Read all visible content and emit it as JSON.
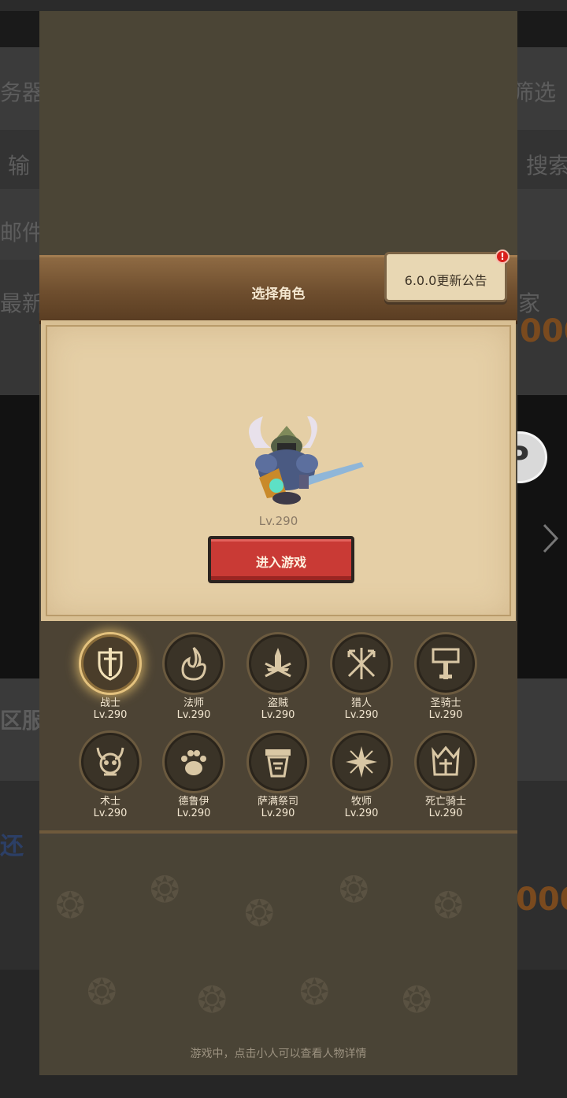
{
  "background_app": {
    "row_left_texts": [
      "务器",
      "输",
      "邮件",
      "最新",
      "区服",
      "还"
    ],
    "filter_label": "筛选",
    "search_label": "搜索",
    "right_fragment": "家",
    "orange_number": "000"
  },
  "game": {
    "header_title": "选择角色",
    "notice_label": "6.0.0更新公告",
    "notice_badge": "!",
    "selected_level": "Lv.290",
    "enter_button": "进入游戏",
    "hint": "游戏中，点击小人可以查看人物详情",
    "classes": [
      {
        "name": "战士",
        "level": "Lv.290",
        "icon": "shield-sword-icon",
        "selected": true
      },
      {
        "name": "法师",
        "level": "Lv.290",
        "icon": "flame-icon"
      },
      {
        "name": "盗贼",
        "level": "Lv.290",
        "icon": "dagger-icon"
      },
      {
        "name": "猎人",
        "level": "Lv.290",
        "icon": "crossed-arrows-icon"
      },
      {
        "name": "圣骑士",
        "level": "Lv.290",
        "icon": "hammer-icon"
      },
      {
        "name": "术士",
        "level": "Lv.290",
        "icon": "horned-skull-icon"
      },
      {
        "name": "德鲁伊",
        "level": "Lv.290",
        "icon": "paw-icon"
      },
      {
        "name": "萨满祭司",
        "level": "Lv.290",
        "icon": "totem-icon"
      },
      {
        "name": "牧师",
        "level": "Lv.290",
        "icon": "holy-star-icon"
      },
      {
        "name": "死亡骑士",
        "level": "Lv.290",
        "icon": "helm-icon"
      }
    ]
  }
}
